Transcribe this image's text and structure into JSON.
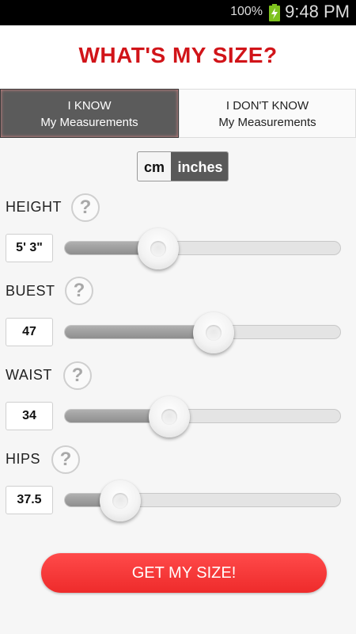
{
  "status_bar": {
    "battery_percent": "100%",
    "time": "9:48 PM",
    "battery_icon": "battery-charging-icon",
    "battery_color": "#7ec21e"
  },
  "header": {
    "title": "WHAT'S MY SIZE?",
    "title_color": "#d11419"
  },
  "tabs": [
    {
      "line1": "I KNOW",
      "line2": "My Measurements",
      "selected": true
    },
    {
      "line1": "I DON'T KNOW",
      "line2": "My Measurements",
      "selected": false
    }
  ],
  "units": {
    "options": [
      "cm",
      "inches"
    ],
    "selected": "inches"
  },
  "measurements": [
    {
      "label": "HEIGHT",
      "value": "5' 3\"",
      "slider_fraction": 0.34
    },
    {
      "label": "BUEST",
      "value": "47",
      "slider_fraction": 0.54
    },
    {
      "label": "WAIST",
      "value": "34",
      "slider_fraction": 0.38
    },
    {
      "label": "HIPS",
      "value": "37.5",
      "slider_fraction": 0.2
    }
  ],
  "help_icon": "question-mark-icon",
  "cta": {
    "label": "GET MY SIZE!",
    "color": "#ef2f2f"
  }
}
